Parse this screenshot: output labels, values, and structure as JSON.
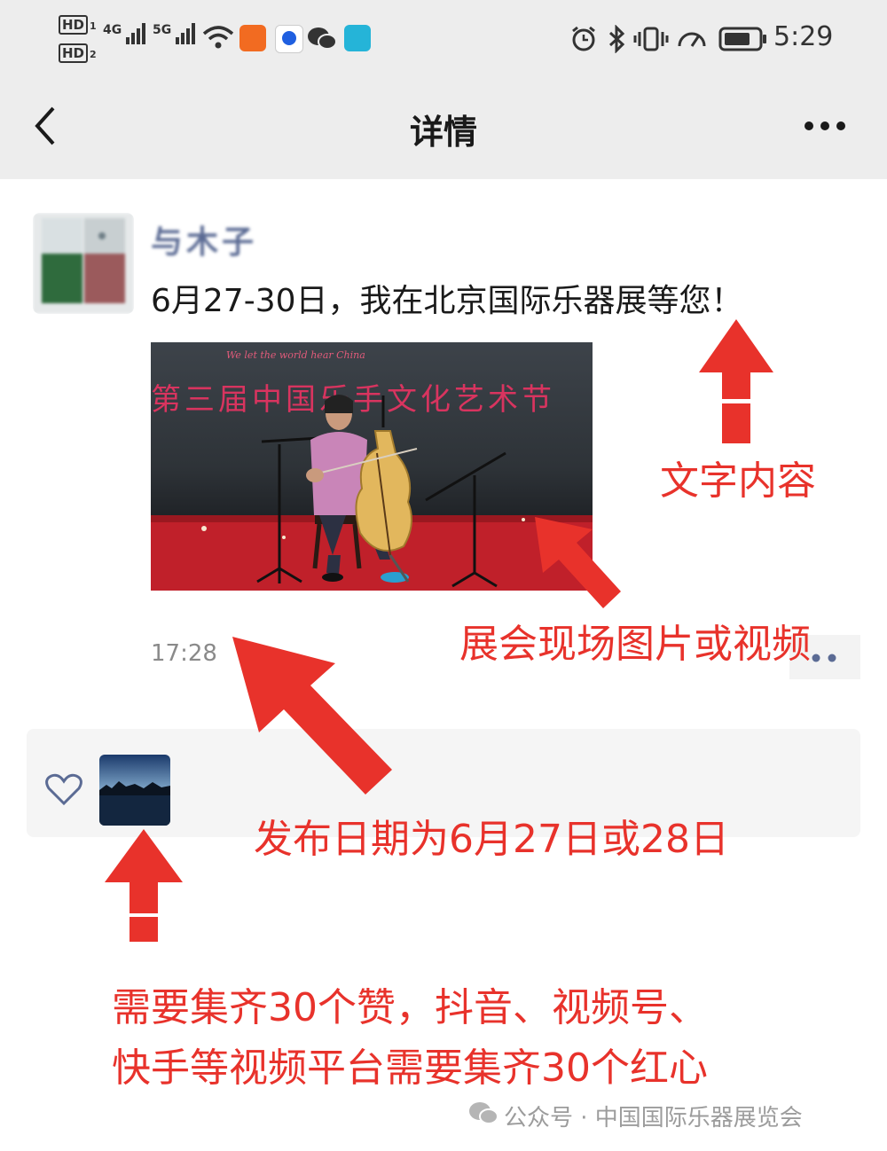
{
  "status_bar": {
    "sim1": "HD",
    "sim2": "HD",
    "net1": "4G",
    "net2": "5G",
    "time": "5:29"
  },
  "nav": {
    "title": "详情"
  },
  "post": {
    "username": "与木子",
    "text": "6月27-30日，我在北京国际乐器展等您！",
    "photo_caption": "We let the world hear China",
    "photo_banner": "第三届中国乐手文化艺术节",
    "time": "17:28"
  },
  "annotations": {
    "text_content": "文字内容",
    "photo_or_video": "展会现场图片或视频",
    "publish_date": "发布日期为6月27日或28日",
    "likes_line1": "需要集齐30个赞，抖音、视频号、",
    "likes_line2": "快手等视频平台需要集齐30个红心"
  },
  "watermark": {
    "text": "公众号 · 中国国际乐器展览会"
  },
  "colors": {
    "annotation_red": "#e8322b",
    "nav_bg": "#ededed",
    "username_blue": "#5b6b94"
  }
}
